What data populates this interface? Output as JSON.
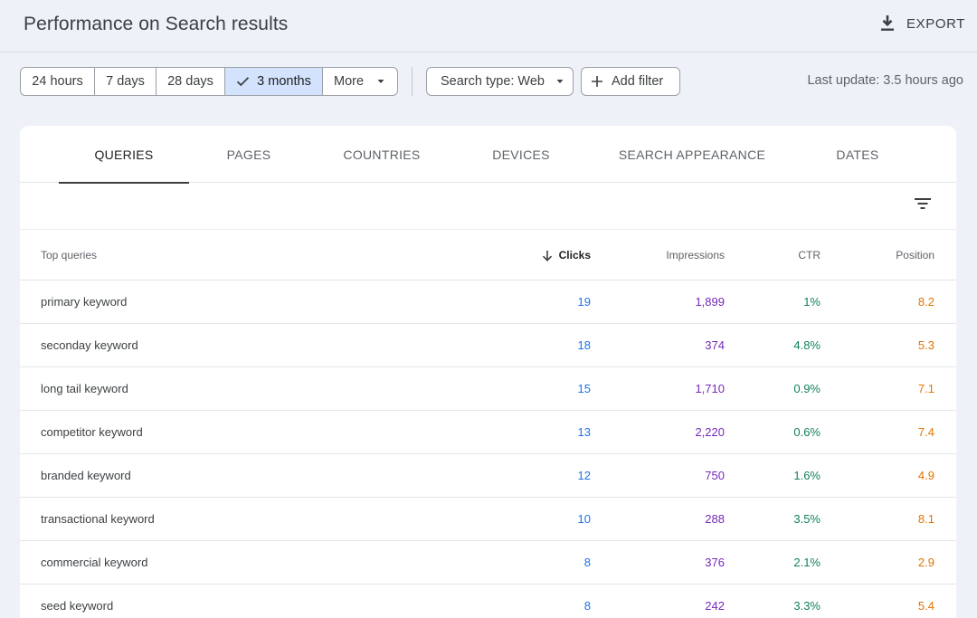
{
  "header": {
    "title": "Performance on Search results",
    "export_label": "EXPORT"
  },
  "date_range": {
    "options": [
      {
        "label": "24 hours",
        "selected": false
      },
      {
        "label": "7 days",
        "selected": false
      },
      {
        "label": "28 days",
        "selected": false
      },
      {
        "label": "3 months",
        "selected": true
      },
      {
        "label": "More",
        "selected": false
      }
    ]
  },
  "search_type_label": "Search type: Web",
  "add_filter_label": "Add filter",
  "last_update": "Last update: 3.5 hours ago",
  "tabs": [
    "QUERIES",
    "PAGES",
    "COUNTRIES",
    "DEVICES",
    "SEARCH APPEARANCE",
    "DATES"
  ],
  "active_tab": "QUERIES",
  "table": {
    "headers": {
      "query": "Top queries",
      "clicks": "Clicks",
      "impressions": "Impressions",
      "ctr": "CTR",
      "position": "Position"
    },
    "sort": {
      "column": "clicks",
      "direction": "descending"
    },
    "rows": [
      {
        "query": "primary keyword",
        "clicks": "19",
        "impressions": "1,899",
        "ctr": "1%",
        "position": "8.2"
      },
      {
        "query": "seconday keyword",
        "clicks": "18",
        "impressions": "374",
        "ctr": "4.8%",
        "position": "5.3"
      },
      {
        "query": "long tail keyword",
        "clicks": "15",
        "impressions": "1,710",
        "ctr": "0.9%",
        "position": "7.1"
      },
      {
        "query": "competitor keyword",
        "clicks": "13",
        "impressions": "2,220",
        "ctr": "0.6%",
        "position": "7.4"
      },
      {
        "query": "branded keyword",
        "clicks": "12",
        "impressions": "750",
        "ctr": "1.6%",
        "position": "4.9"
      },
      {
        "query": "transactional keyword",
        "clicks": "10",
        "impressions": "288",
        "ctr": "3.5%",
        "position": "8.1"
      },
      {
        "query": "commercial keyword",
        "clicks": "8",
        "impressions": "376",
        "ctr": "2.1%",
        "position": "2.9"
      },
      {
        "query": "seed keyword",
        "clicks": "8",
        "impressions": "242",
        "ctr": "3.3%",
        "position": "5.4"
      }
    ]
  },
  "colors": {
    "clicks": "#1a73e8",
    "impressions": "#7627bb",
    "ctr": "#12805c",
    "position": "#e37400",
    "selected_chip": "#d3e3fd",
    "background": "#eef2f8"
  },
  "icons": {
    "export": "download-icon",
    "selected": "check-icon",
    "dropdown": "caret-down-icon",
    "add": "plus-icon",
    "table_filter": "filter-list-icon",
    "sort": "arrow-down-icon"
  }
}
